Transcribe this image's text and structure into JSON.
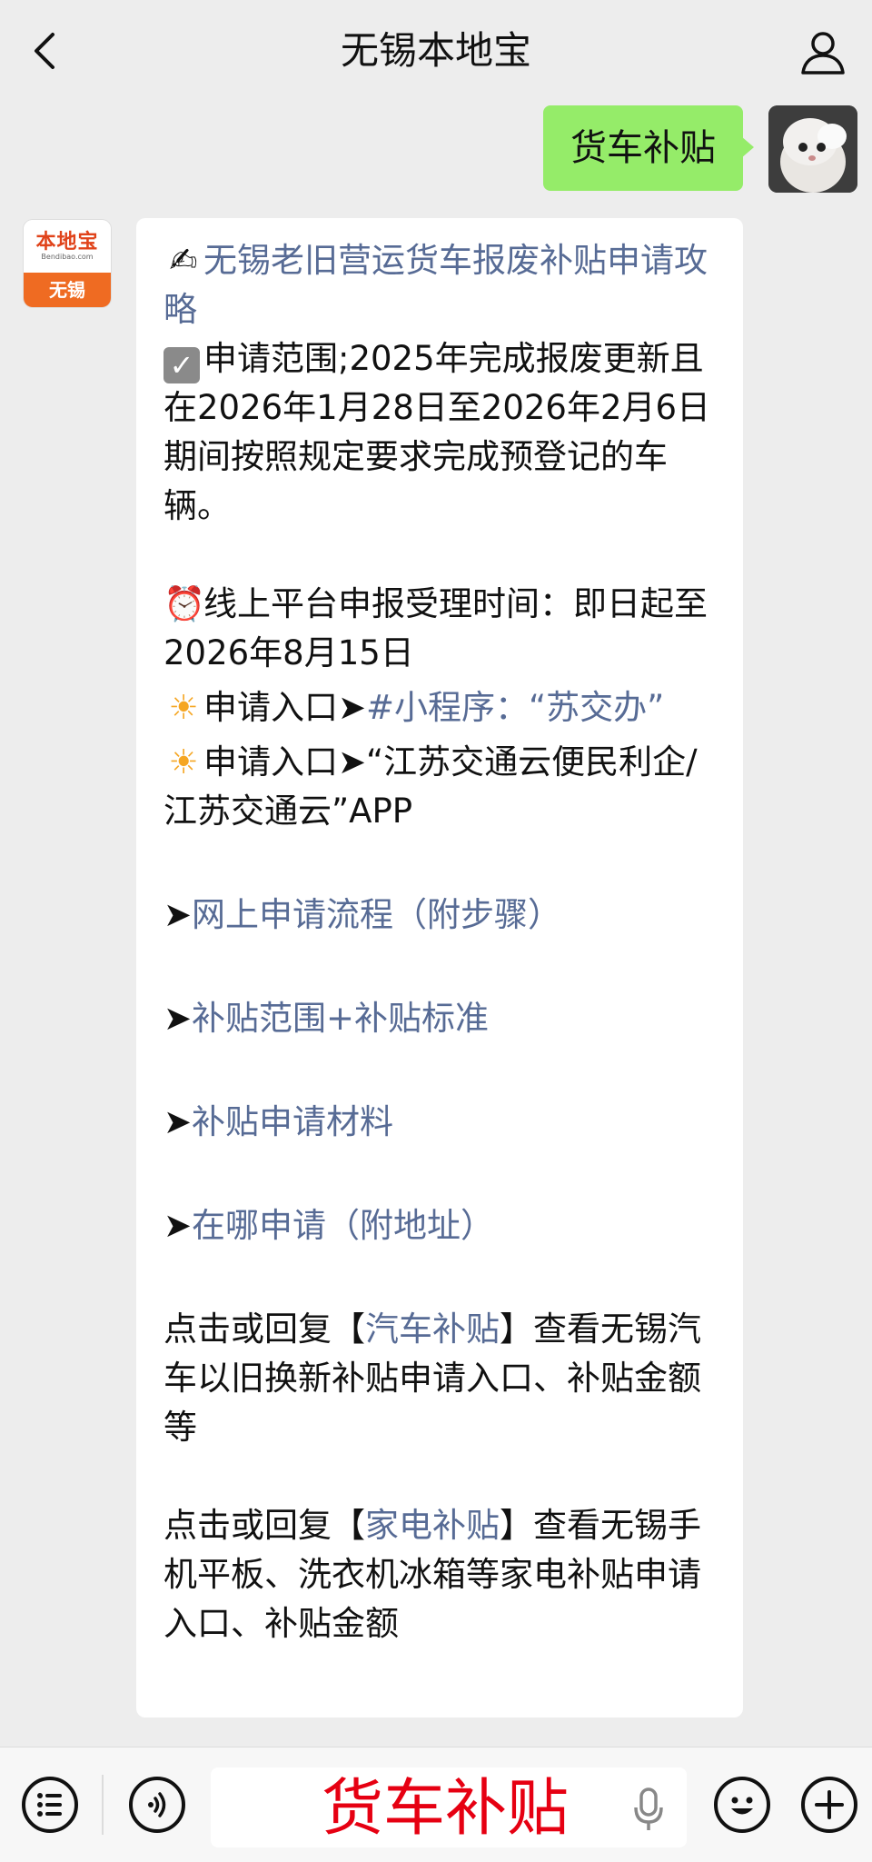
{
  "header": {
    "title": "无锡本地宝"
  },
  "outgoing": {
    "text": "货车补贴"
  },
  "bot": {
    "logo_text": "本地宝",
    "logo_sub": "Bendibao.com",
    "logo_city": "无锡"
  },
  "message": {
    "title_emoji": "✍",
    "title": "无锡老旧营运货车报废补贴申请攻略",
    "scope": "申请范围;2025年完成报废更新且在2026年1月28日至2026年2月6日期间按照规定要求完成预登记的车辆。",
    "time_emoji": "⏰",
    "time": "线上平台申报受理时间：即日起至2026年8月15日",
    "entry1_emoji": "☀",
    "entry1_label": "申请入口➤",
    "entry1_link": "#小程序：“苏交办”",
    "entry2_emoji": "☀",
    "entry2_text": "申请入口➤“江苏交通云便民利企/江苏交通云”APP",
    "arrow": "➤",
    "link_process": "网上申请流程（附步骤）",
    "link_scope": "补贴范围+补贴标准",
    "link_materials": "补贴申请材料",
    "link_where": "在哪申请（附地址）",
    "car_prefix": "点击或回复【",
    "car_link": "汽车补贴",
    "car_suffix": "】查看无锡汽车以旧换新补贴申请入口、补贴金额等",
    "appliance_prefix": "点击或回复【",
    "appliance_link": "家电补贴",
    "appliance_suffix": "】查看无锡手机平板、洗衣机冰箱等家电补贴申请入口、补贴金额"
  },
  "input": {
    "value": "货车补贴"
  }
}
